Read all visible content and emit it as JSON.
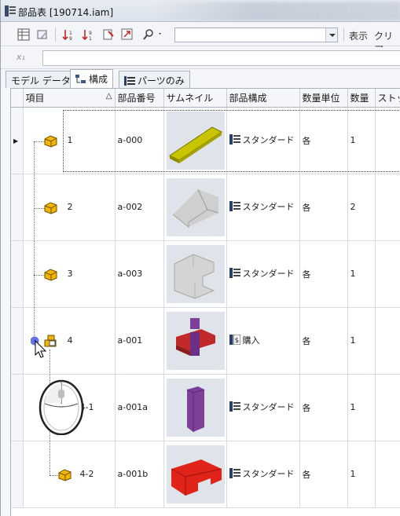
{
  "window": {
    "title": "部品表 [190714.iam]"
  },
  "toolbar": {
    "combo_value": "",
    "display_label": "表示",
    "clear_label": "クリア"
  },
  "formula": {
    "fx_label": "x₁",
    "value": ""
  },
  "tabs": [
    {
      "label": "モデル データ",
      "active": false
    },
    {
      "label": "構成",
      "active": true
    },
    {
      "label": "パーツのみ",
      "active": false
    }
  ],
  "columns": [
    "項目",
    "部品番号",
    "サムネイル",
    "部品構成",
    "数量単位",
    "数量",
    "ストック"
  ],
  "rows": [
    {
      "item": "1",
      "part_no": "a-000",
      "structure": "スタンダード",
      "unit": "各",
      "qty": "1",
      "level": 0,
      "thumb_color": "#c8c400"
    },
    {
      "item": "2",
      "part_no": "a-002",
      "structure": "スタンダード",
      "unit": "各",
      "qty": "2",
      "level": 0,
      "thumb_color": "#cfcfcf"
    },
    {
      "item": "3",
      "part_no": "a-003",
      "structure": "スタンダード",
      "unit": "各",
      "qty": "1",
      "level": 0,
      "thumb_color": "#d4d4d4"
    },
    {
      "item": "4",
      "part_no": "a-001",
      "structure": "購入",
      "unit": "各",
      "qty": "1",
      "level": 0,
      "thumb_color": "#c22a2a"
    },
    {
      "item": "4-1",
      "part_no": "a-001a",
      "structure": "スタンダード",
      "unit": "各",
      "qty": "1",
      "level": 1,
      "thumb_color": "#7d3f9a"
    },
    {
      "item": "4-2",
      "part_no": "a-001b",
      "structure": "スタンダード",
      "unit": "各",
      "qty": "1",
      "level": 1,
      "thumb_color": "#e0241a"
    }
  ],
  "colors": {
    "part_icon": "#f2b600",
    "selection_dot": "#4a5be0"
  }
}
